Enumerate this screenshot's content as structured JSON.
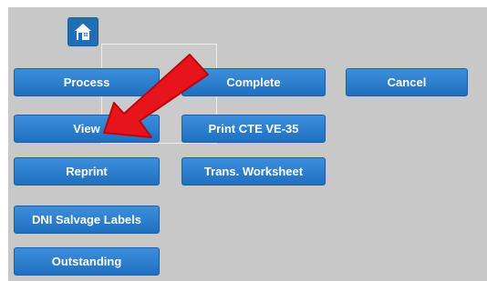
{
  "icons": {
    "home": "home-icon",
    "arrow": "red-arrow-annotation"
  },
  "colors": {
    "button_blue": "#2a7bd0",
    "panel_gray": "#c8c8c8",
    "arrow_red": "#e8141b"
  },
  "buttons": {
    "process": "Process",
    "complete": "Complete",
    "cancel": "Cancel",
    "view": "View",
    "print_cte": "Print CTE VE-35",
    "reprint": "Reprint",
    "trans_worksheet": "Trans. Worksheet",
    "dni_salvage": "DNI Salvage Labels",
    "outstanding": "Outstanding"
  }
}
